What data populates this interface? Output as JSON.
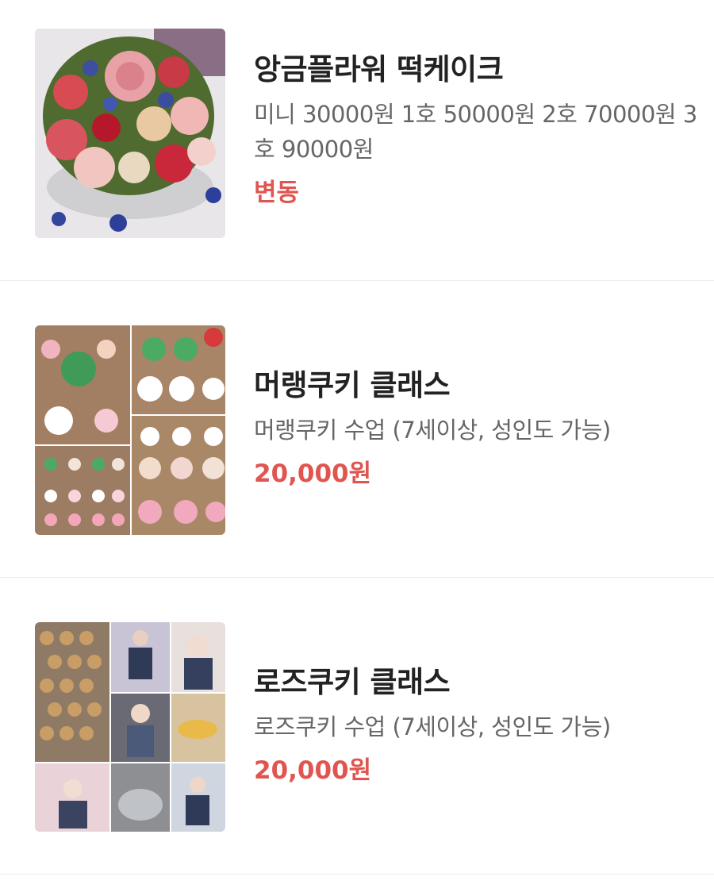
{
  "menu_items": [
    {
      "title": "앙금플라워 떡케이크",
      "description": "미니 30000원 1호 50000원 2호 70000원 3호 90000원",
      "price": "변동",
      "image": "flower-rice-cake-photo"
    },
    {
      "title": "머랭쿠키 클래스",
      "description": "머랭쿠키 수업 (7세이상, 성인도 가능)",
      "price": "20,000원",
      "image": "meringue-cookies-collage"
    },
    {
      "title": "로즈쿠키 클래스",
      "description": "로즈쿠키 수업 (7세이상, 성인도 가능)",
      "price": "20,000원",
      "image": "rose-cookie-class-collage"
    }
  ],
  "colors": {
    "price": "#e05550",
    "title": "#222222",
    "description": "#666666",
    "divider": "#ececec"
  }
}
